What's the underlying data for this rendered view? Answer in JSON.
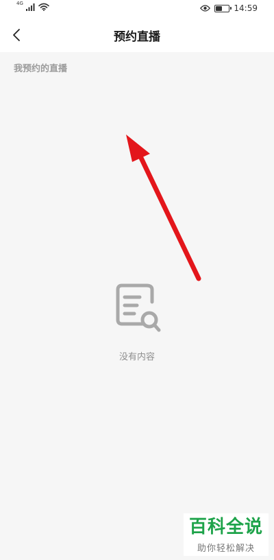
{
  "status_bar": {
    "network": "4G",
    "time": "14:59",
    "battery_level": 0.5,
    "icons": [
      "signal-icon",
      "wifi-icon",
      "eye-icon",
      "battery-icon"
    ]
  },
  "header": {
    "title": "预约直播",
    "back_icon": "chevron-left-icon"
  },
  "section": {
    "label": "我预约的直播"
  },
  "empty_state": {
    "icon": "document-search-icon",
    "text": "没有内容"
  },
  "annotation": {
    "icon": "red-arrow-icon",
    "color": "#e3161b"
  },
  "watermark": {
    "title": "百科全说",
    "subtitle": "助你轻松解决",
    "color": "#1ea34a"
  }
}
